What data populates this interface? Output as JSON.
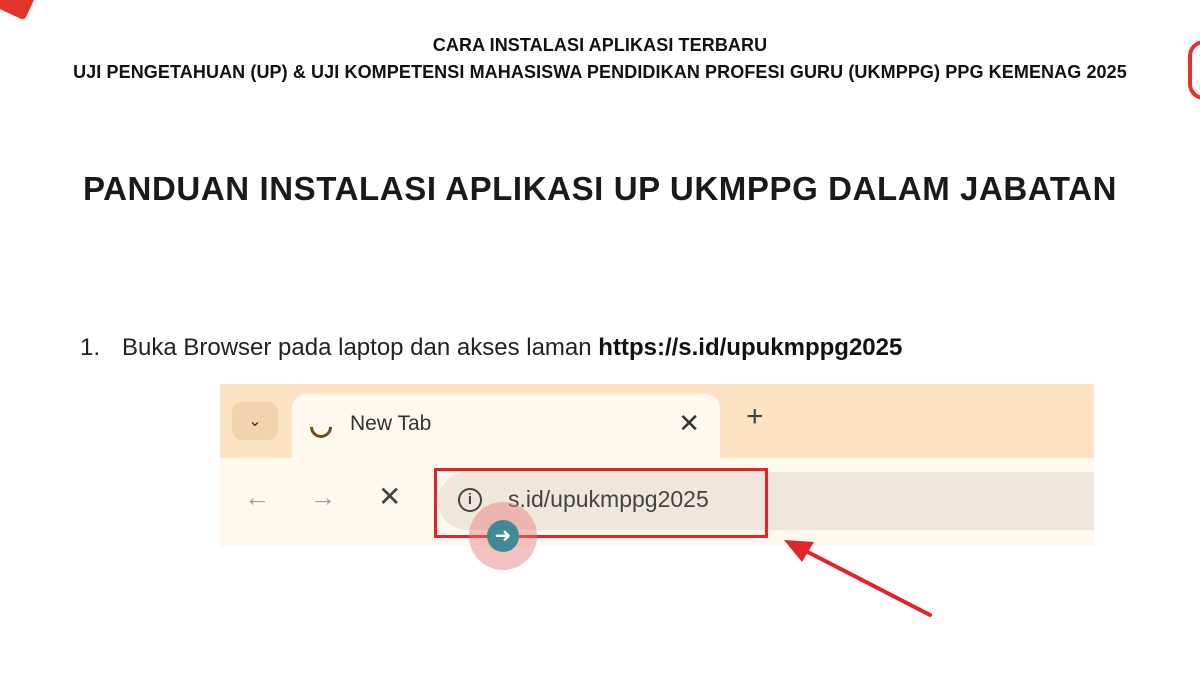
{
  "header": {
    "line1": "CARA INSTALASI APLIKASI TERBARU",
    "line2": "UJI PENGETAHUAN (UP) & UJI KOMPETENSI MAHASISWA PENDIDIKAN PROFESI GURU (UKMPPG) PPG KEMENAG 2025"
  },
  "document": {
    "title": "PANDUAN INSTALASI APLIKASI UP UKMPPG DALAM JABATAN",
    "step": {
      "number": "1.",
      "text": "Buka Browser pada laptop dan akses laman ",
      "url": "https://s.id/upukmppg2025"
    }
  },
  "browser": {
    "tab_title": "New Tab",
    "address": "s.id/upukmppg2025",
    "icons": {
      "tab_dropdown": "chevron-down-icon",
      "tab_loading": "loading-spinner-icon",
      "tab_close": "close-icon",
      "new_tab": "plus-icon",
      "back": "arrow-left-icon",
      "forward": "arrow-right-icon",
      "stop": "close-icon",
      "site_info": "info-icon"
    },
    "colors": {
      "tabbar": "#fbe3c4",
      "active_tab": "#fff8ef",
      "omnibox": "#efe7dc"
    }
  },
  "annotation": {
    "highlight_color": "#e3232a",
    "cursor_color": "#3f8a95"
  }
}
